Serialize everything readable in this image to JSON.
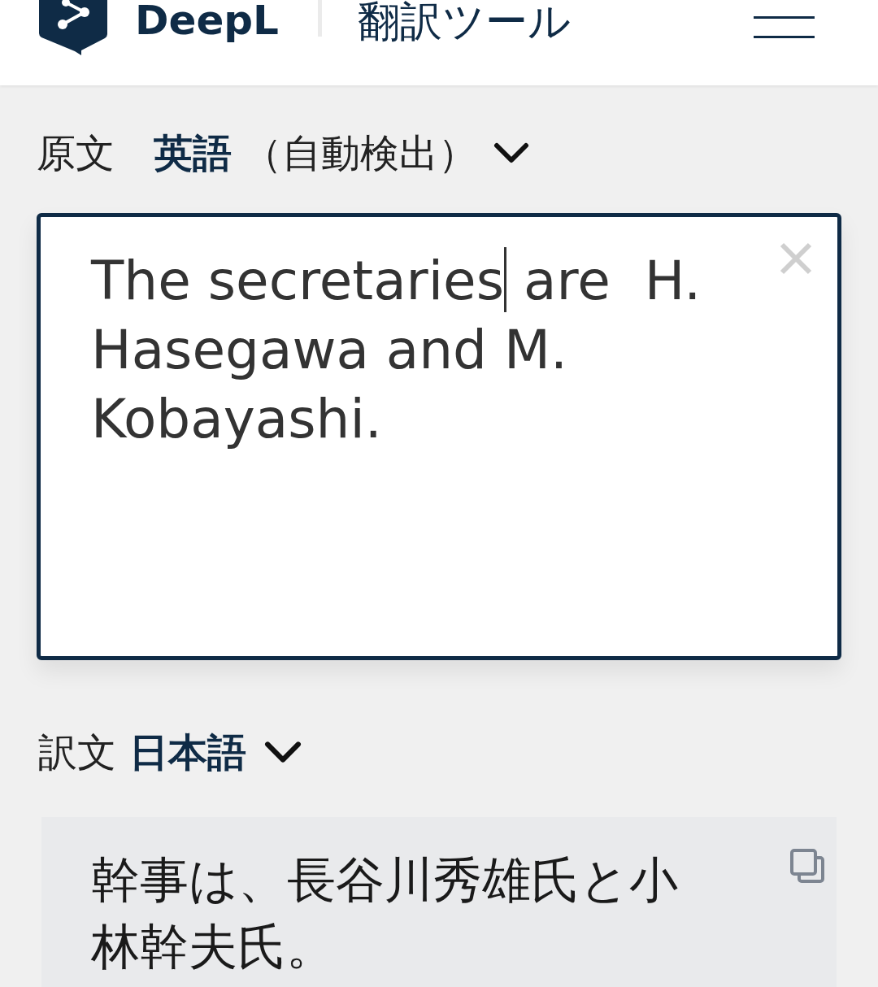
{
  "header": {
    "logo_text": "DeepL",
    "subtitle": "翻訳ツール"
  },
  "source": {
    "label": "原文",
    "language": "英語",
    "note": "（自動検出）",
    "text_before_cursor": "The secretaries",
    "text_after_cursor": " are  H. Hasegawa and M. Kobayashi."
  },
  "target": {
    "label": "訳文",
    "language": "日本語",
    "text": "幹事は、長谷川秀雄氏と小林幹夫氏。"
  }
}
